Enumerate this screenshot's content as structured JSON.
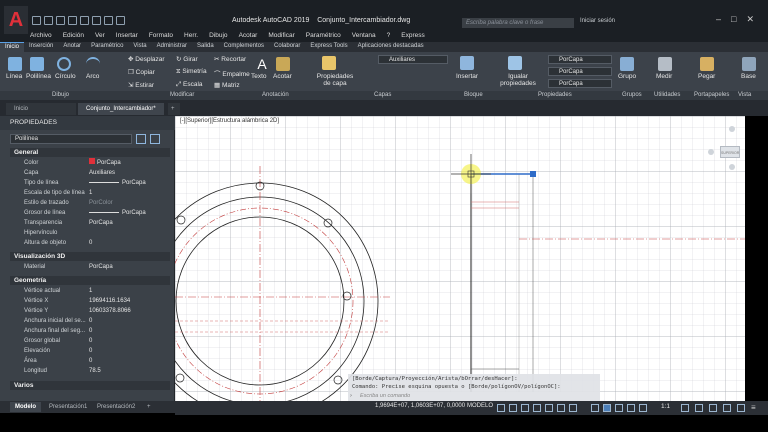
{
  "app": {
    "logo": "A",
    "title": "Autodesk AutoCAD 2019",
    "file": "Conjunto_Intercambiador.dwg",
    "search_placeholder": "Escriba palabra clave o frase",
    "signin": "Iniciar sesión"
  },
  "menu": [
    "Archivo",
    "Edición",
    "Ver",
    "Insertar",
    "Formato",
    "Herr.",
    "Dibujo",
    "Acotar",
    "Modificar",
    "Paramétrico",
    "Ventana",
    "?",
    "Express"
  ],
  "ribbon_tabs": [
    "Inicio",
    "Inserción",
    "Anotar",
    "Paramétrico",
    "Vista",
    "Administrar",
    "Salida",
    "Complementos",
    "Colaborar",
    "Express Tools",
    "Aplicaciones destacadas"
  ],
  "ribbon": {
    "draw_tools": [
      "Línea",
      "Polilínea",
      "Círculo",
      "Arco"
    ],
    "modify_tools": [
      "Desplazar",
      "Girar",
      "Recortar",
      "Copiar",
      "Simetría",
      "Empalme",
      "Estirar",
      "Escala",
      "Matriz"
    ],
    "annotation_tools": [
      "Texto",
      "Acotar"
    ],
    "layer_props": "Propiedades de capa",
    "layer_name": "Auxiliares",
    "insert": "Insertar",
    "match_props": "Igualar propiedades",
    "color": "PorCapa",
    "linetype": "PorCapa",
    "lineweight": "PorCapa",
    "group": "Grupo",
    "measure": "Medir",
    "paste": "Pegar",
    "base": "Base",
    "panels": [
      "Dibujo",
      "Modificar",
      "Anotación",
      "Capas",
      "Bloque",
      "Propiedades",
      "Grupos",
      "Utilidades",
      "Portapapeles",
      "Vista"
    ]
  },
  "file_tabs": [
    "Inicio",
    "Conjunto_Intercambiador*"
  ],
  "palette": {
    "title": "PROPIEDADES",
    "object": "Polilínea",
    "general_title": "General",
    "general": [
      {
        "label": "Color",
        "value": "PorCapa"
      },
      {
        "label": "Capa",
        "value": "Auxiliares"
      },
      {
        "label": "Tipo de línea",
        "value": "PorCapa"
      },
      {
        "label": "Escala de tipo de línea",
        "value": "1"
      },
      {
        "label": "Estilo de trazado",
        "value": "PorColor"
      },
      {
        "label": "Grosor de línea",
        "value": "PorCapa"
      },
      {
        "label": "Transparencia",
        "value": "PorCapa"
      },
      {
        "label": "Hipervínculo",
        "value": ""
      },
      {
        "label": "Altura de objeto",
        "value": "0"
      }
    ],
    "vis3d_title": "Visualización 3D",
    "vis3d": [
      {
        "label": "Material",
        "value": "PorCapa"
      }
    ],
    "geom_title": "Geometría",
    "geom": [
      {
        "label": "Vértice actual",
        "value": "1"
      },
      {
        "label": "Vértice X",
        "value": "19694116.1634"
      },
      {
        "label": "Vértice Y",
        "value": "10603378.8066"
      },
      {
        "label": "Anchura inicial del se...",
        "value": "0"
      },
      {
        "label": "Anchura final del seg...",
        "value": "0"
      },
      {
        "label": "Grosor global",
        "value": "0"
      },
      {
        "label": "Elevación",
        "value": "0"
      },
      {
        "label": "Área",
        "value": "0"
      },
      {
        "label": "Longitud",
        "value": "78.5"
      }
    ],
    "misc_title": "Varios"
  },
  "layout_tabs": [
    "Modelo",
    "Presentación1",
    "Presentación2"
  ],
  "viewport_label": "[-][Superior][Estructura alámbrica 2D]",
  "viewcube_label": "SUPERIOR",
  "command": {
    "line1": "[Borde/Captura/Proyección/Arista/bOrrar/desHacer]:",
    "line2": "Comando: Precise esquina opuesta o [Borde/polígonOV/polígonOC]:",
    "input_placeholder": "Escriba un comando"
  },
  "status": {
    "coords": "1,9694E+07, 1,0603E+07, 0,0000",
    "model": "MODELO",
    "scale": "1:1"
  },
  "colors": {
    "accent": "#5aa0e6",
    "title_red": "#e0303a",
    "ribbon_bg": "#3c424a",
    "center_line": "#d83a3a"
  }
}
